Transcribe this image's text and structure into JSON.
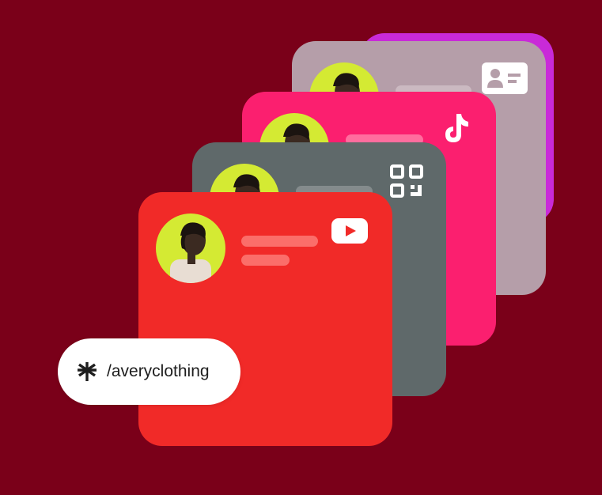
{
  "profile": {
    "handle": "/averyclothing"
  },
  "cards": [
    {
      "name": "purple-back-card",
      "color": "#c92ad8"
    },
    {
      "name": "contact-card",
      "color": "#b59ea9",
      "icon": "contact-card-icon"
    },
    {
      "name": "tiktok-card",
      "color": "#fb1f6f",
      "icon": "tiktok-icon"
    },
    {
      "name": "qr-card",
      "color": "#5f696a",
      "icon": "qr-code-icon"
    },
    {
      "name": "youtube-card",
      "color": "#f12a28",
      "icon": "youtube-icon"
    }
  ],
  "colors": {
    "background": "#7a0019",
    "avatar_ring": "#d4ea33",
    "placeholder_red": "#fb6e6a",
    "placeholder_pink": "#ff6d9e",
    "placeholder_gray": "#848b8c",
    "placeholder_mauve": "#cbb9c1"
  },
  "brand_icon": "linktree-asterisk-icon"
}
